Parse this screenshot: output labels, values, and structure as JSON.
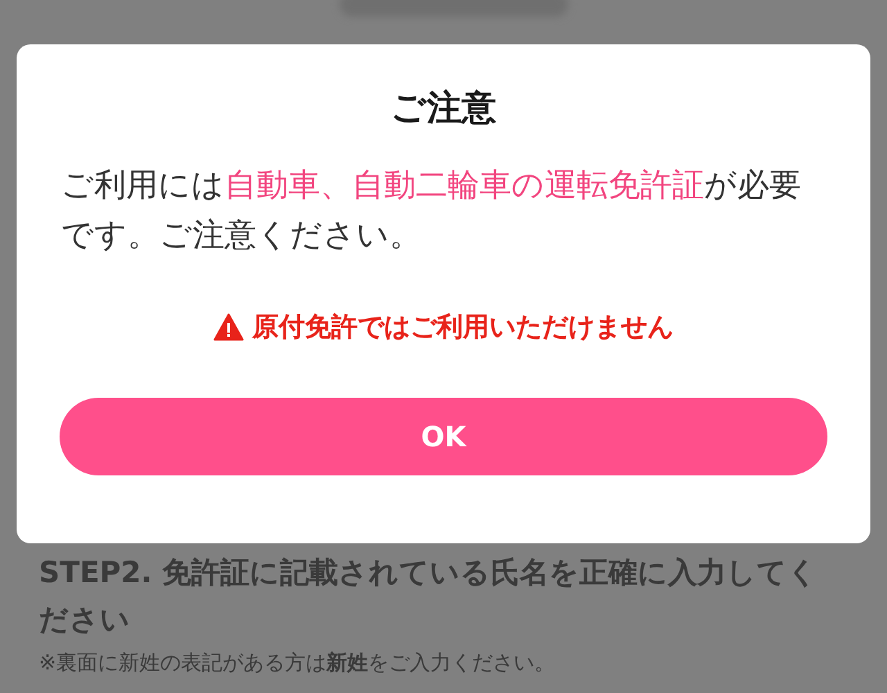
{
  "dialog": {
    "title": "ご注意",
    "message": [
      {
        "text": "ご利用には",
        "highlight": false
      },
      {
        "text": "自動車、自動二輪車の運転免許証",
        "highlight": true
      },
      {
        "text": "が必要です。ご注意ください。",
        "highlight": false
      }
    ],
    "warning": "原付免許ではご利用いただけません",
    "button": "OK"
  },
  "background": {
    "step": "STEP2. 免許証に記載されている氏名を正確に入力してください",
    "note": "※裏面に新姓の表記がある方は**新姓**をご入力ください。"
  }
}
